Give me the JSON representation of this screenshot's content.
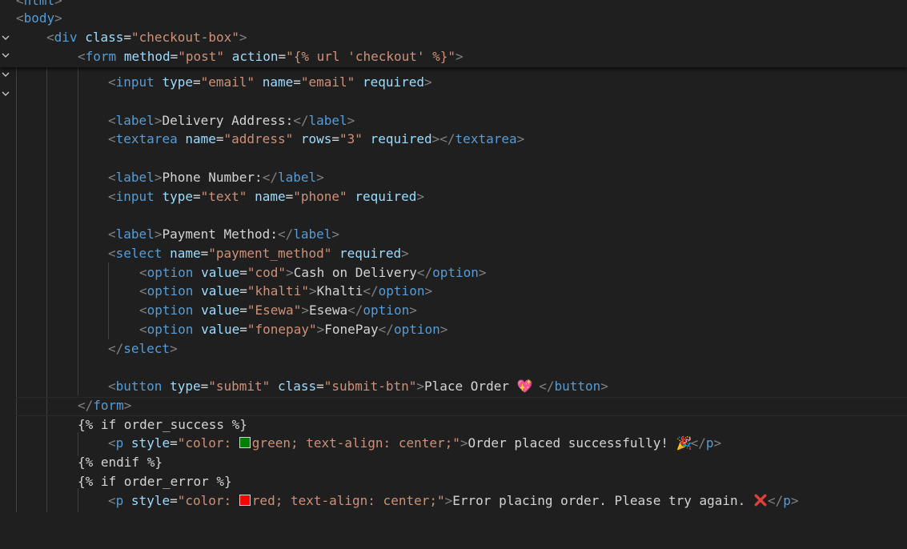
{
  "colors": {
    "background": "#1f1f1f",
    "tag": "#569cd6",
    "attr": "#9cdcfe",
    "string": "#ce9178",
    "text": "#d4d4d4",
    "bracket": "#808080",
    "green_swatch": "#008000",
    "red_swatch": "#ff0000"
  },
  "sticky": {
    "line0": {
      "tag": "html"
    },
    "line1": {
      "tag": "body"
    },
    "line2": {
      "tag": "div",
      "attr": "class",
      "val": "\"checkout-box\""
    },
    "line3": {
      "tag": "form",
      "attr1": "method",
      "val1": "\"post\"",
      "attr2": "action",
      "val2": "\"{% url 'checkout' %}\""
    }
  },
  "code": {
    "email_input": {
      "tag": "input",
      "a1": "type",
      "v1": "\"email\"",
      "a2": "name",
      "v2": "\"email\"",
      "a3": "required"
    },
    "label_address": {
      "tag": "label",
      "text": "Delivery Address:"
    },
    "textarea": {
      "tag": "textarea",
      "a1": "name",
      "v1": "\"address\"",
      "a2": "rows",
      "v2": "\"3\"",
      "a3": "required"
    },
    "label_phone": {
      "tag": "label",
      "text": "Phone Number:"
    },
    "phone_input": {
      "tag": "input",
      "a1": "type",
      "v1": "\"text\"",
      "a2": "name",
      "v2": "\"phone\"",
      "a3": "required"
    },
    "label_payment": {
      "tag": "label",
      "text": "Payment Method:"
    },
    "select": {
      "tag": "select",
      "a1": "name",
      "v1": "\"payment_method\"",
      "a2": "required"
    },
    "options": [
      {
        "val": "\"cod\"",
        "text": "Cash on Delivery"
      },
      {
        "val": "\"khalti\"",
        "text": "Khalti"
      },
      {
        "val": "\"Esewa\"",
        "text": "Esewa"
      },
      {
        "val": "\"fonepay\"",
        "text": "FonePay"
      }
    ],
    "option_tag": "option",
    "option_attr": "value",
    "select_close": "select",
    "button": {
      "tag": "button",
      "a1": "type",
      "v1": "\"submit\"",
      "a2": "class",
      "v2": "\"submit-btn\"",
      "text": "Place Order ",
      "emoji": "💖"
    },
    "form_close": "form",
    "if_success": "{% if order_success %}",
    "p_success": {
      "tag": "p",
      "attr": "style",
      "val_pre": "\"color: ",
      "val_post": "green; text-align: center;\"",
      "text": "Order placed successfully! ",
      "emoji": "🎉"
    },
    "endif": "{% endif %}",
    "if_error": "{% if order_error %}",
    "p_error": {
      "tag": "p",
      "attr": "style",
      "val_pre": "\"color: ",
      "val_post": "red; text-align: center;\"",
      "text": "Error placing order. Please try again. ",
      "emoji": "❌"
    }
  }
}
